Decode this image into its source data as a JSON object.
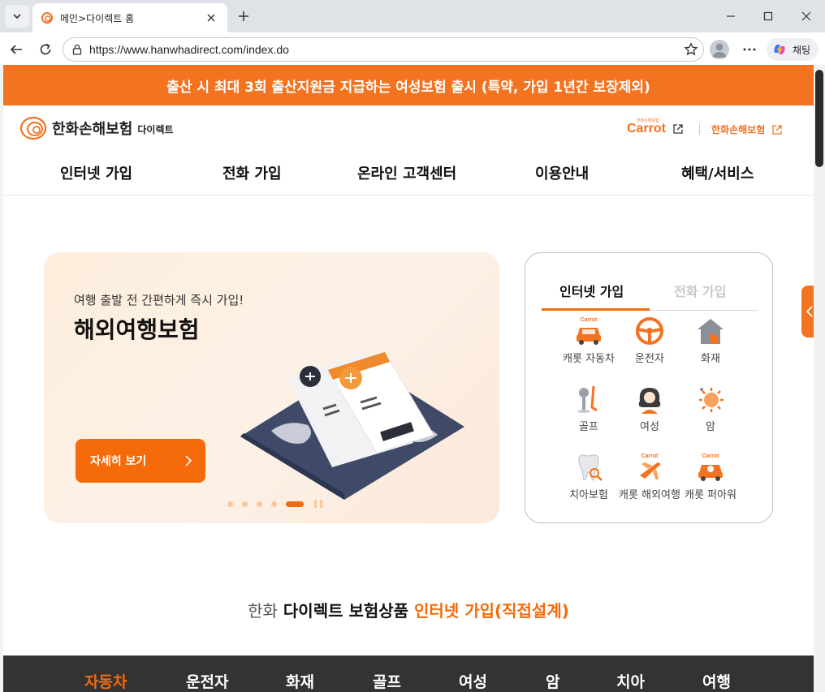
{
  "browser": {
    "tab_title": "메인>다이렉트 홈",
    "url": "https://www.hanwhadirect.com/index.do",
    "copilot_label": "채팅"
  },
  "banner": {
    "text": "출산 시 최대 3회 출산지원금 지급하는 여성보험 출시 (특약, 가입 1년간 보장제외)"
  },
  "header": {
    "logo_text": "한화손해보험",
    "logo_sub": "다이렉트",
    "carrot_small": "한화손해보험",
    "carrot_link": "Carrot",
    "hanwha_link": "한화손해보험"
  },
  "gnb": [
    {
      "label": "인터넷 가입"
    },
    {
      "label": "전화 가입"
    },
    {
      "label": "온라인 고객센터"
    },
    {
      "label": "이용안내"
    },
    {
      "label": "혜택/서비스"
    }
  ],
  "hero": {
    "subtitle": "여행 출발 전 간편하게 즉시 가입!",
    "title": "해외여행보험",
    "button_label": "자세히 보기",
    "slide_count": 5,
    "active_slide": 5
  },
  "quick": {
    "tabs": [
      {
        "label": "인터넷 가입",
        "active": true
      },
      {
        "label": "전화 가입",
        "active": false
      }
    ],
    "items": [
      {
        "label": "캐롯 자동차",
        "icon": "carrot-car-icon"
      },
      {
        "label": "운전자",
        "icon": "steering-wheel-icon"
      },
      {
        "label": "화재",
        "icon": "house-fire-icon"
      },
      {
        "label": "골프",
        "icon": "golf-icon"
      },
      {
        "label": "여성",
        "icon": "woman-icon"
      },
      {
        "label": "암",
        "icon": "cancer-cell-icon"
      },
      {
        "label": "치아보험",
        "icon": "tooth-icon"
      },
      {
        "label": "캐롯 해외여행",
        "icon": "carrot-travel-icon"
      },
      {
        "label": "캐롯 퍼아워",
        "icon": "carrot-per-hour-icon"
      }
    ]
  },
  "section": {
    "title_part1": "한화",
    "title_part2": "다이렉트 보험상품",
    "title_part3": "인터넷 가입(직접설계)"
  },
  "products": [
    {
      "label": "자동차",
      "active": true
    },
    {
      "label": "운전자",
      "active": false
    },
    {
      "label": "화재",
      "active": false
    },
    {
      "label": "골프",
      "active": false
    },
    {
      "label": "여성",
      "active": false
    },
    {
      "label": "암",
      "active": false
    },
    {
      "label": "치아",
      "active": false
    },
    {
      "label": "여행",
      "active": false
    }
  ],
  "colors": {
    "brand_orange": "#f37321",
    "accent_orange": "#f56b0a",
    "product_bar": "#333333"
  }
}
